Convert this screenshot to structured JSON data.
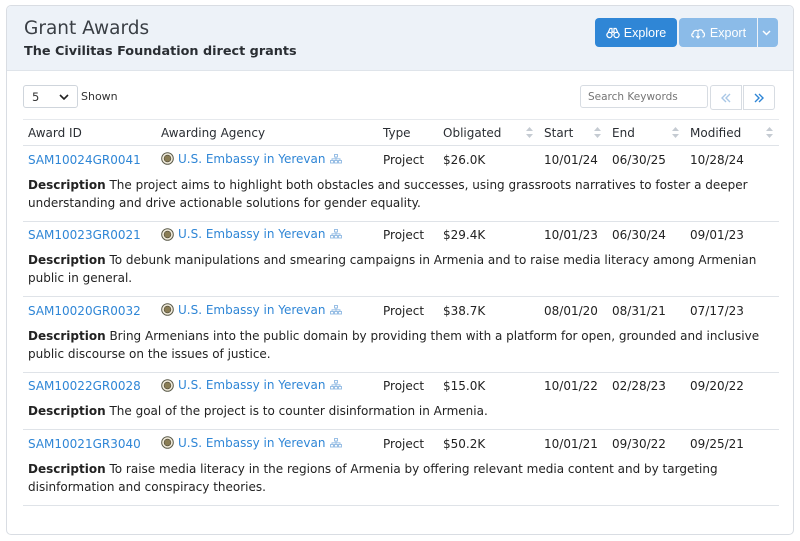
{
  "header": {
    "title": "Grant Awards",
    "subtitle": "The Civilitas Foundation direct grants",
    "explore_label": "Explore",
    "export_label": "Export"
  },
  "toolbar": {
    "page_size": "5",
    "shown_label": "Shown",
    "search_placeholder": "Search Keywords"
  },
  "columns": [
    "Award ID",
    "Awarding Agency",
    "Type",
    "Obligated",
    "Start",
    "End",
    "Modified"
  ],
  "desc_label": "Description",
  "awards": [
    {
      "id": "SAM10024GR0041",
      "agency": "U.S. Embassy in Yerevan",
      "type": "Project",
      "obligated": "$26.0K",
      "start": "10/01/24",
      "end": "06/30/25",
      "modified": "10/28/24",
      "description": "The project aims to highlight both obstacles and successes, using grassroots narratives to foster a deeper understanding and drive actionable solutions for gender equality."
    },
    {
      "id": "SAM10023GR0021",
      "agency": "U.S. Embassy in Yerevan",
      "type": "Project",
      "obligated": "$29.4K",
      "start": "10/01/23",
      "end": "06/30/24",
      "modified": "09/01/23",
      "description": "To debunk manipulations and smearing campaigns in Armenia and to raise media literacy among Armenian public in general."
    },
    {
      "id": "SAM10020GR0032",
      "agency": "U.S. Embassy in Yerevan",
      "type": "Project",
      "obligated": "$38.7K",
      "start": "08/01/20",
      "end": "08/31/21",
      "modified": "07/17/23",
      "description": "Bring Armenians into the public domain by providing them with a platform for open, grounded and inclusive public discourse on the issues of justice."
    },
    {
      "id": "SAM10022GR0028",
      "agency": "U.S. Embassy in Yerevan",
      "type": "Project",
      "obligated": "$15.0K",
      "start": "10/01/22",
      "end": "02/28/23",
      "modified": "09/20/22",
      "description": "The goal of the project is to counter disinformation in Armenia."
    },
    {
      "id": "SAM10021GR3040",
      "agency": "U.S. Embassy in Yerevan",
      "type": "Project",
      "obligated": "$50.2K",
      "start": "10/01/21",
      "end": "09/30/22",
      "modified": "09/25/21",
      "description": "To raise media literacy in the regions of Armenia by offering relevant media content and by targeting disinformation and conspiracy theories."
    }
  ],
  "colors": {
    "accent": "#2f86d6",
    "header_bg": "#edf2f8",
    "export_bg": "#8bbbe8"
  },
  "icons": [
    "binoculars-icon",
    "cloud-download-icon",
    "chevron-down-icon",
    "double-chevron-left-icon",
    "double-chevron-right-icon",
    "sort-icon",
    "seal-icon",
    "org-tree-icon"
  ]
}
